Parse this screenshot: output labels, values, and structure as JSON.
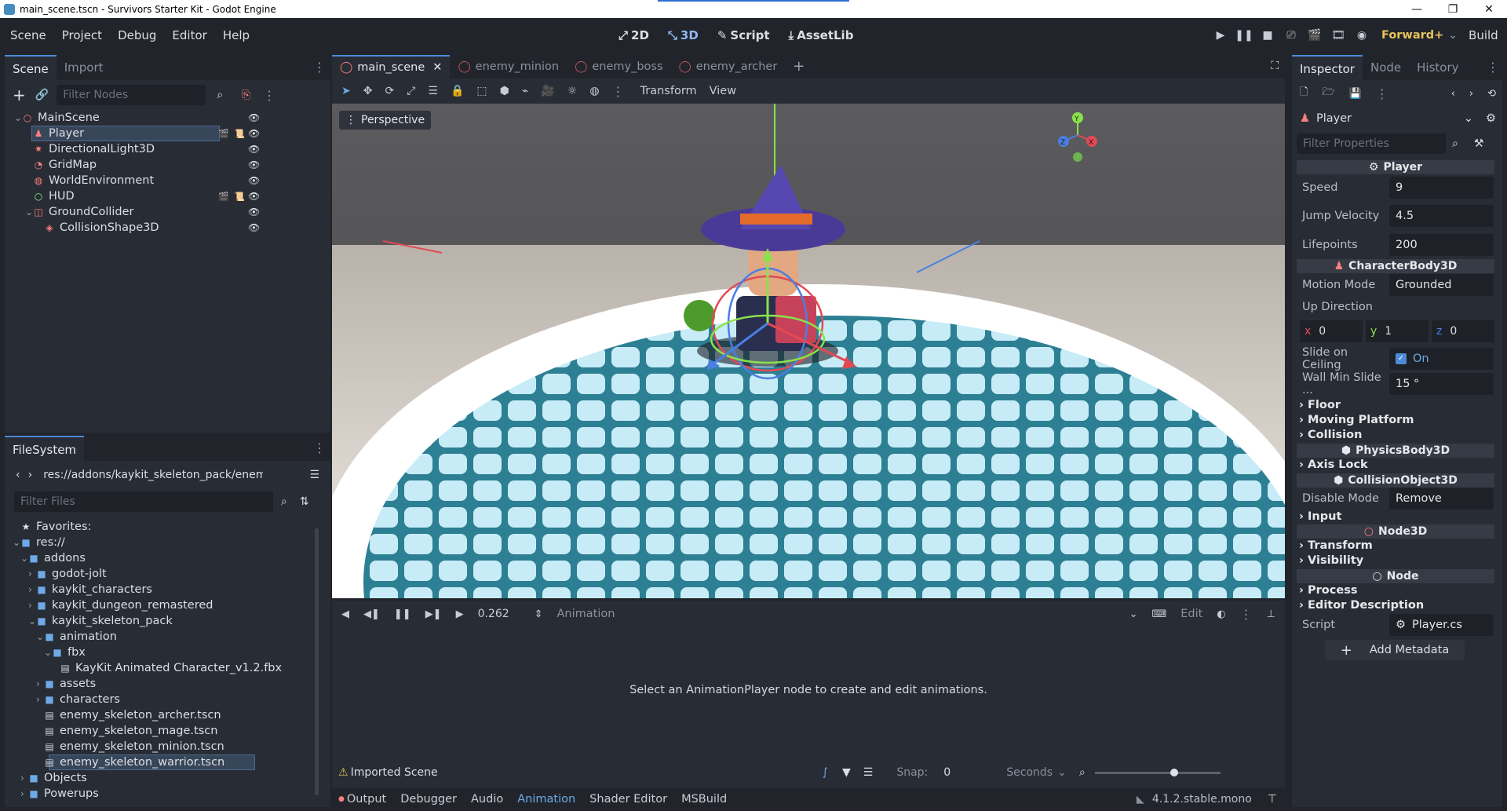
{
  "window": {
    "title": "main_scene.tscn - Survivors Starter Kit - Godot Engine",
    "controls": [
      "—",
      "❐",
      "✕"
    ]
  },
  "menu": [
    "Scene",
    "Project",
    "Debug",
    "Editor",
    "Help"
  ],
  "modes": [
    {
      "icon": "2d-icon",
      "glyph": "⤢",
      "label": "2D"
    },
    {
      "icon": "3d-icon",
      "glyph": "⤡",
      "label": "3D"
    },
    {
      "icon": "script-icon",
      "glyph": "✎",
      "label": "Script"
    },
    {
      "icon": "assetlib-icon",
      "glyph": "⤓",
      "label": "AssetLib"
    }
  ],
  "renderer": "Forward+",
  "build_label": "Build",
  "scene_dock": {
    "tabs": [
      "Scene",
      "Import"
    ],
    "filter_placeholder": "Filter Nodes",
    "nodes": [
      {
        "label": "MainScene",
        "color": "#fc7f7f",
        "glyph": "○",
        "indent": 0,
        "arrow": "⌄"
      },
      {
        "label": "Player",
        "color": "#fc7f7f",
        "glyph": "♟",
        "indent": 1,
        "arrow": "",
        "selected": true
      },
      {
        "label": "DirectionalLight3D",
        "color": "#fc7f7f",
        "glyph": "✷",
        "indent": 1,
        "arrow": ""
      },
      {
        "label": "GridMap",
        "color": "#fc7f7f",
        "glyph": "◔",
        "indent": 1,
        "arrow": ""
      },
      {
        "label": "WorldEnvironment",
        "color": "#fc7f7f",
        "glyph": "◍",
        "indent": 1,
        "arrow": ""
      },
      {
        "label": "HUD",
        "color": "#8eef97",
        "glyph": "○",
        "indent": 1,
        "arrow": ""
      },
      {
        "label": "GroundCollider",
        "color": "#fc7f7f",
        "glyph": "◫",
        "indent": 1,
        "arrow": "⌄"
      },
      {
        "label": "CollisionShape3D",
        "color": "#fc7f7f",
        "glyph": "◈",
        "indent": 2,
        "arrow": ""
      }
    ]
  },
  "filesystem": {
    "tab": "FileSystem",
    "path": "res://addons/kaykit_skeleton_pack/enemy_sk",
    "filter_placeholder": "Filter Files",
    "items": [
      {
        "label": "Favorites:",
        "type": "star",
        "indent": 0,
        "arrow": ""
      },
      {
        "label": "res://",
        "type": "folder",
        "indent": 0,
        "arrow": "⌄"
      },
      {
        "label": "addons",
        "type": "folder",
        "indent": 1,
        "arrow": "⌄"
      },
      {
        "label": "godot-jolt",
        "type": "folder",
        "indent": 2,
        "arrow": "›"
      },
      {
        "label": "kaykit_characters",
        "type": "folder",
        "indent": 2,
        "arrow": "›"
      },
      {
        "label": "kaykit_dungeon_remastered",
        "type": "folder",
        "indent": 2,
        "arrow": "›"
      },
      {
        "label": "kaykit_skeleton_pack",
        "type": "folder",
        "indent": 2,
        "arrow": "⌄"
      },
      {
        "label": "animation",
        "type": "folder",
        "indent": 3,
        "arrow": "⌄"
      },
      {
        "label": "fbx",
        "type": "folder",
        "indent": 4,
        "arrow": "⌄"
      },
      {
        "label": "KayKit Animated Character_v1.2.fbx",
        "type": "file",
        "indent": 5,
        "arrow": ""
      },
      {
        "label": "assets",
        "type": "folder",
        "indent": 3,
        "arrow": "›"
      },
      {
        "label": "characters",
        "type": "folder",
        "indent": 3,
        "arrow": "›"
      },
      {
        "label": "enemy_skeleton_archer.tscn",
        "type": "file",
        "indent": 3,
        "arrow": ""
      },
      {
        "label": "enemy_skeleton_mage.tscn",
        "type": "file",
        "indent": 3,
        "arrow": ""
      },
      {
        "label": "enemy_skeleton_minion.tscn",
        "type": "file",
        "indent": 3,
        "arrow": ""
      },
      {
        "label": "enemy_skeleton_warrior.tscn",
        "type": "file",
        "indent": 3,
        "arrow": "",
        "selected": true
      },
      {
        "label": "Objects",
        "type": "folder",
        "indent": 1,
        "arrow": "›"
      },
      {
        "label": "Powerups",
        "type": "folder",
        "indent": 1,
        "arrow": "›"
      }
    ]
  },
  "scene_tabs": [
    {
      "label": "main_scene",
      "active": true
    },
    {
      "label": "enemy_minion",
      "active": false
    },
    {
      "label": "enemy_boss",
      "active": false
    },
    {
      "label": "enemy_archer",
      "active": false
    }
  ],
  "viewport_toolbar": {
    "transform": "Transform",
    "view": "View",
    "perspective": "Perspective"
  },
  "animation_panel": {
    "time": "0.262",
    "animation_label": "Animation",
    "edit_label": "Edit",
    "empty_message": "Select an AnimationPlayer node to create and edit animations.",
    "imported_scene": "Imported Scene",
    "snap_label": "Snap:",
    "snap_value": "0",
    "seconds_label": "Seconds"
  },
  "bottom_tabs": [
    "Output",
    "Debugger",
    "Audio",
    "Animation",
    "Shader Editor",
    "MSBuild"
  ],
  "active_bottom_tab": "Animation",
  "version": "4.1.2.stable.mono",
  "inspector": {
    "tabs": [
      "Inspector",
      "Node",
      "History"
    ],
    "object_name": "Player",
    "filter_placeholder": "Filter Properties",
    "class_player": "Player",
    "speed_label": "Speed",
    "speed_value": "9",
    "jump_label": "Jump Velocity",
    "jump_value": "4.5",
    "lifepoints_label": "Lifepoints",
    "lifepoints_value": "200",
    "class_characterbody": "CharacterBody3D",
    "motion_mode_label": "Motion Mode",
    "motion_mode_value": "Grounded",
    "up_direction_label": "Up Direction",
    "up_x": "0",
    "up_y": "1",
    "up_z": "0",
    "slide_label": "Slide on Ceiling",
    "slide_value": "On",
    "wall_label": "Wall Min Slide ...",
    "wall_value": "15 °",
    "floor": "Floor",
    "moving_platform": "Moving Platform",
    "collision": "Collision",
    "class_physicsbody": "PhysicsBody3D",
    "axis_lock": "Axis Lock",
    "class_collisionobject": "CollisionObject3D",
    "disable_mode_label": "Disable Mode",
    "disable_mode_value": "Remove",
    "input": "Input",
    "class_node3d": "Node3D",
    "transform": "Transform",
    "visibility": "Visibility",
    "class_node": "Node",
    "process": "Process",
    "editor_description": "Editor Description",
    "script_label": "Script",
    "script_value": "Player.cs",
    "add_metadata": "Add Metadata"
  }
}
